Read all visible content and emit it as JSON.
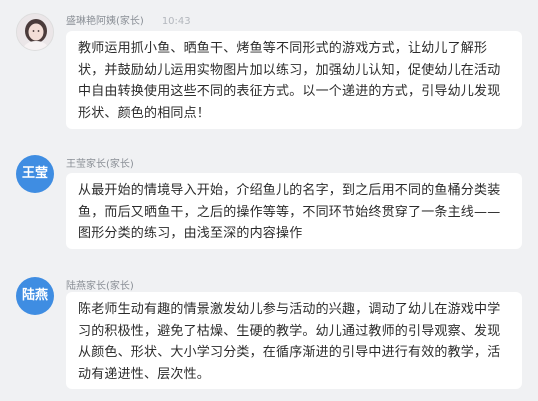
{
  "messages": [
    {
      "sender": "盛琳艳阿姨(家长)",
      "time": "10:43",
      "avatar_text": "",
      "avatar_kind": "photo",
      "text": "教师运用抓小鱼、晒鱼干、烤鱼等不同形式的游戏方式，让幼儿了解形状，并鼓励幼儿运用实物图片加以练习，加强幼儿认知，促使幼儿在活动中自由转换使用这些不同的表征方式。以一个递进的方式，引导幼儿发现形状、颜色的相同点！"
    },
    {
      "sender": "王莹家长(家长)",
      "time": "",
      "avatar_text": "王莹",
      "avatar_kind": "text",
      "text": "从最开始的情境导入开始，介绍鱼儿的名字，到之后用不同的鱼桶分类装鱼，而后又晒鱼干，之后的操作等等，不同环节始终贯穿了一条主线——图形分类的练习，由浅至深的内容操作"
    },
    {
      "sender": "陆燕家长(家长)",
      "time": "",
      "avatar_text": "陆燕",
      "avatar_kind": "text",
      "text": "陈老师生动有趣的情景激发幼儿参与活动的兴趣，调动了幼儿在游戏中学习的积极性，避免了枯燥、生硬的教学。幼儿通过教师的引导观察、发现从颜色、形状、大小学习分类，在循序渐进的引导中进行有效的教学，活动有递进性、层次性。"
    }
  ],
  "colors": {
    "background": "#f0f1f3",
    "bubble": "#ffffff",
    "avatar_blue": "#3f8de2",
    "meta_text": "#8a8f96"
  }
}
